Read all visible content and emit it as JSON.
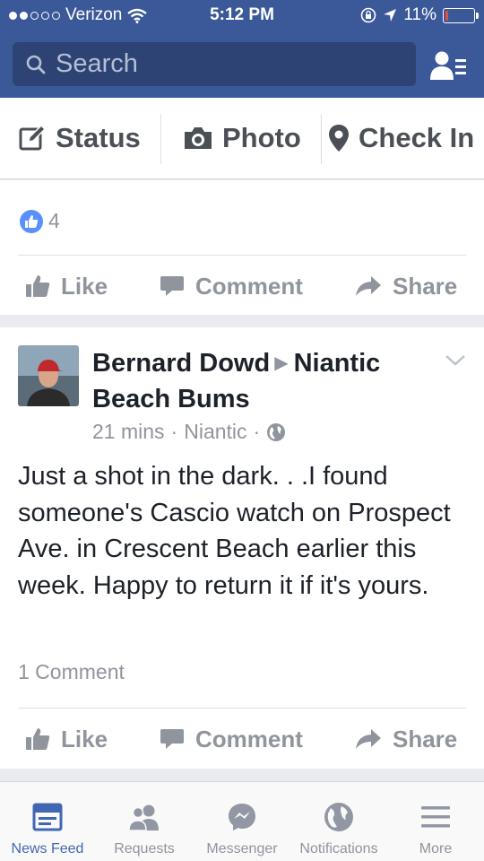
{
  "status_bar": {
    "carrier": "Verizon",
    "time": "5:12 PM",
    "battery": "11%",
    "battery_level": 0.11,
    "signal_bars": 2
  },
  "header": {
    "search_placeholder": "Search",
    "friend_requests_icon": "friend-list-icon"
  },
  "composer": {
    "status_label": "Status",
    "photo_label": "Photo",
    "checkin_label": "Check In"
  },
  "post1": {
    "like_count": "4",
    "actions": {
      "like": "Like",
      "comment": "Comment",
      "share": "Share"
    }
  },
  "post2": {
    "author": "Bernard Dowd",
    "group": "Niantic Beach Bums",
    "time": "21 mins",
    "location": "Niantic",
    "separator": "·",
    "text": "Just a shot in the dark. . .I found someone's Cascio watch on Prospect Ave. in Crescent Beach earlier this week. Happy to return it if it's yours.",
    "comment_count": "1 Comment",
    "actions": {
      "like": "Like",
      "comment": "Comment",
      "share": "Share"
    }
  },
  "tabbar": {
    "tabs": [
      {
        "label": "News Feed",
        "icon": "news-feed-icon",
        "active": true
      },
      {
        "label": "Requests",
        "icon": "requests-icon",
        "active": false
      },
      {
        "label": "Messenger",
        "icon": "messenger-icon",
        "active": false
      },
      {
        "label": "Notifications",
        "icon": "globe-icon",
        "active": false
      },
      {
        "label": "More",
        "icon": "menu-icon",
        "active": false
      }
    ]
  },
  "colors": {
    "brand": "#3b5998",
    "active_tab": "#4267b2",
    "muted": "#90949c",
    "like_blue": "#5890ff"
  }
}
